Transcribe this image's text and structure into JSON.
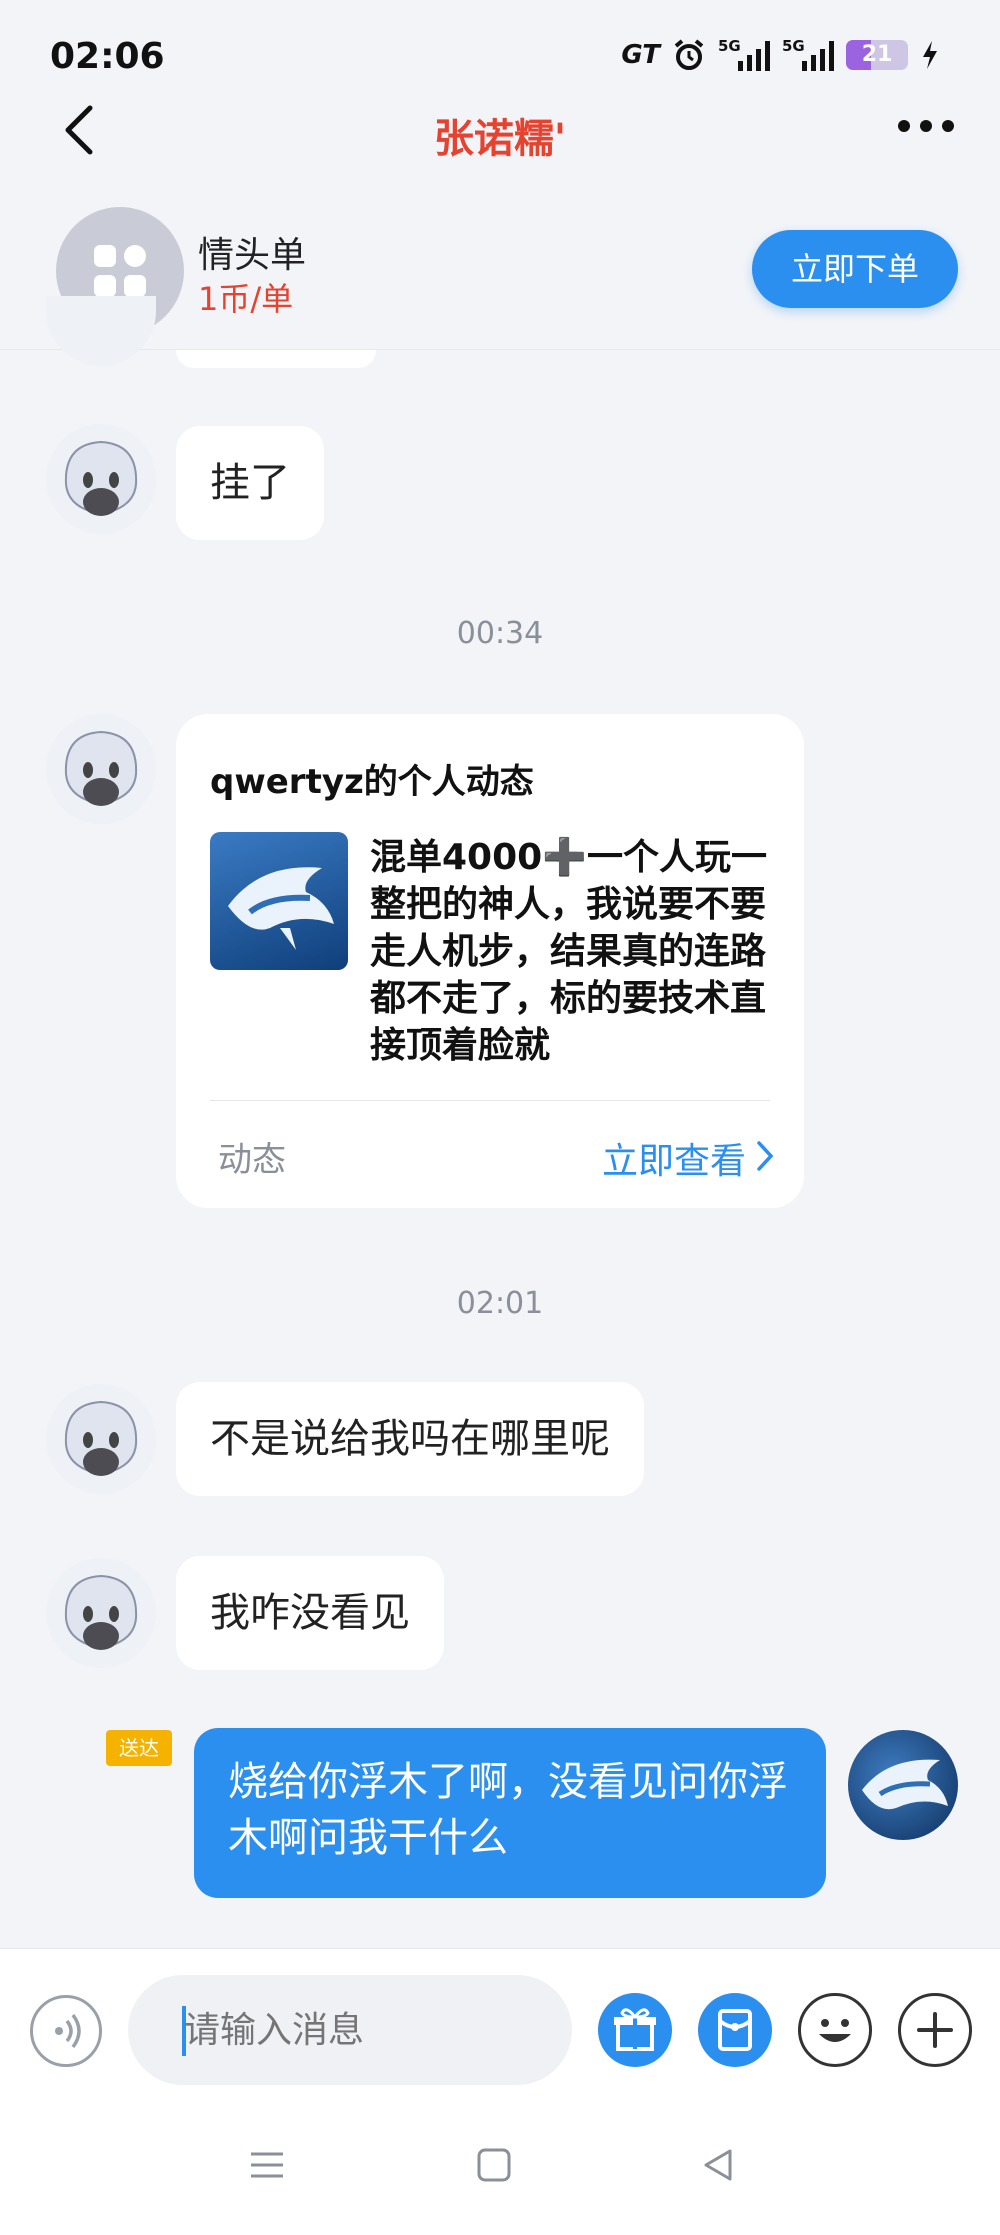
{
  "status_bar": {
    "time": "02:06",
    "carrier_badge": "GT",
    "signal1_label": "5G",
    "signal2_label": "5G",
    "battery_level": "21",
    "icons": [
      "alarm-icon",
      "signal-icon",
      "battery-icon",
      "charging-icon"
    ]
  },
  "header": {
    "title": "张诺糯'",
    "title_color": "#e5432f"
  },
  "service": {
    "name": "情头单",
    "price": "1币/单",
    "order_button": "立即下单"
  },
  "messages": {
    "m1": "挂了",
    "time1": "00:34",
    "card": {
      "title": "qwertyz的个人动态",
      "body": "混单4000➕一个人玩一整把的神人，我说要不要走人机步，结果真的连路都不走了，标的要技术直接顶着脸就",
      "footer_left": "动态",
      "footer_right": "立即查看"
    },
    "time2": "02:01",
    "m2": "不是说给我吗在哪里呢",
    "m3": "我咋没看见",
    "sent_status": "送达",
    "sent": "烧给你浮木了啊，没看见问你浮木啊问我干什么"
  },
  "input": {
    "placeholder": "请输入消息"
  },
  "colors": {
    "accent": "#2b8ff0",
    "background": "#f2f4f8"
  }
}
